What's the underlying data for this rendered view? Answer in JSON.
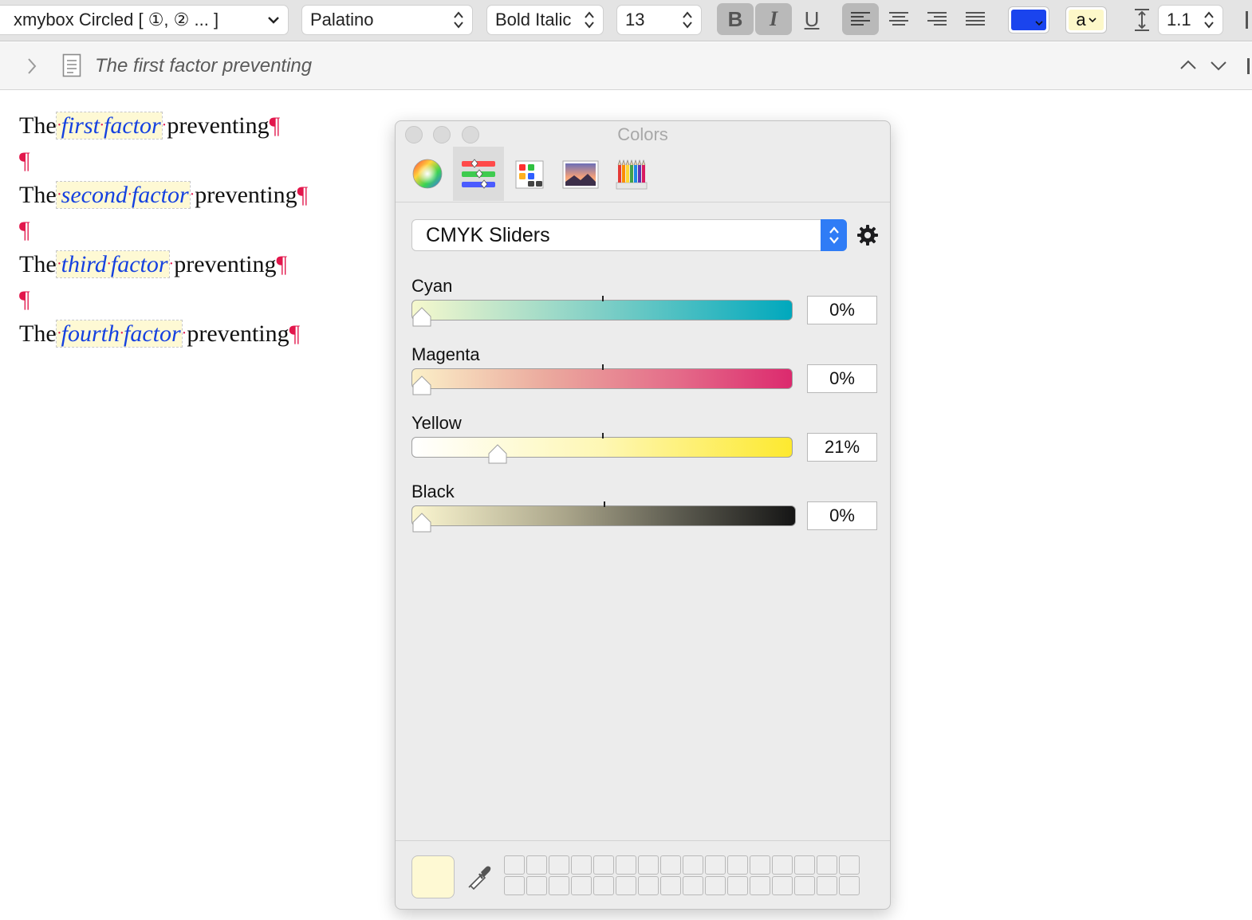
{
  "toolbar": {
    "style_menu": "xmybox Circled [ ①, ② ... ]",
    "font_family": "Palatino",
    "font_style": "Bold Italic",
    "font_size": "13",
    "bold_label": "B",
    "italic_label": "I",
    "underline_label": "U",
    "text_color": "#1a44ee",
    "highlight_label": "a",
    "highlight_color": "#fdf8c9",
    "line_spacing": "1.1"
  },
  "breadcrumb": {
    "title": "The first factor preventing"
  },
  "document": {
    "lines": [
      {
        "pre": "The",
        "hl": "first",
        "hl2": "factor",
        "post": "preventing"
      },
      {
        "pre": "The",
        "hl": "second",
        "hl2": "factor",
        "post": "preventing"
      },
      {
        "pre": "The",
        "hl": "third",
        "hl2": "factor",
        "post": "preventing"
      },
      {
        "pre": "The",
        "hl": "fourth",
        "hl2": "factor",
        "post": "preventing"
      }
    ],
    "pilcrow": "¶",
    "space_dot": "·"
  },
  "colors_panel": {
    "title": "Colors",
    "mode_popup": "CMYK Sliders",
    "sliders": [
      {
        "label": "Cyan",
        "value": "0%",
        "level": 0.0
      },
      {
        "label": "Magenta",
        "value": "0%",
        "level": 0.0
      },
      {
        "label": "Yellow",
        "value": "21%",
        "level": 0.21
      },
      {
        "label": "Black",
        "value": "0%",
        "level": 0.0
      }
    ],
    "current_color": "#fef9d3"
  }
}
